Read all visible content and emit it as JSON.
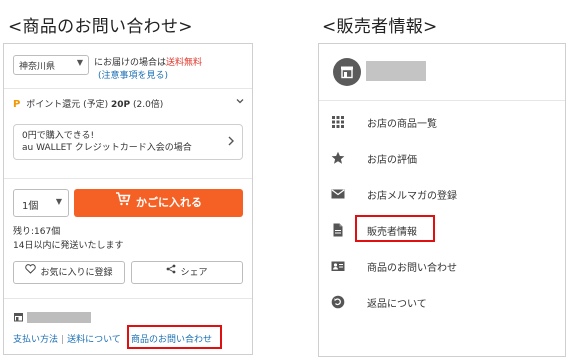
{
  "headings": {
    "left": "<商品のお問い合わせ>",
    "right": "<販売者情報>"
  },
  "product_panel": {
    "prefecture": "神奈川県",
    "shipping_line1_prefix": "にお届けの場合は",
    "shipping_free": "送料無料",
    "shipping_notice": "(注意事項を見る)",
    "points": {
      "icon": "P",
      "label_prefix": "ポイント還元 (予定)",
      "value": "20P",
      "rate": "(2.0倍)"
    },
    "promo": {
      "line1": "0円で購入できる!",
      "line2": "au WALLET クレジットカード入会の場合"
    },
    "quantity": "1個",
    "add_to_cart": "かごに入れる",
    "stock_line1": "残り:167個",
    "stock_line2": "14日以内に発送いたします",
    "favorite_button": "お気に入りに登録",
    "share_button": "シェア",
    "links": {
      "payment": "支払い方法",
      "separator": "|",
      "shipping": "送料について",
      "inquiry": "商品のお問い合わせ"
    }
  },
  "seller_panel": {
    "menu": [
      {
        "label": "お店の商品一覧",
        "icon": "grid-icon"
      },
      {
        "label": "お店の評価",
        "icon": "star-icon"
      },
      {
        "label": "お店メルマガの登録",
        "icon": "mail-icon"
      },
      {
        "label": "販売者情報",
        "icon": "document-icon"
      },
      {
        "label": "商品のお問い合わせ",
        "icon": "contact-card-icon"
      },
      {
        "label": "返品について",
        "icon": "return-icon"
      }
    ]
  },
  "colors": {
    "accent_orange": "#f56125",
    "link_blue": "#1a6fb4",
    "free_red": "#e0372c",
    "highlight_red": "#e01010"
  }
}
